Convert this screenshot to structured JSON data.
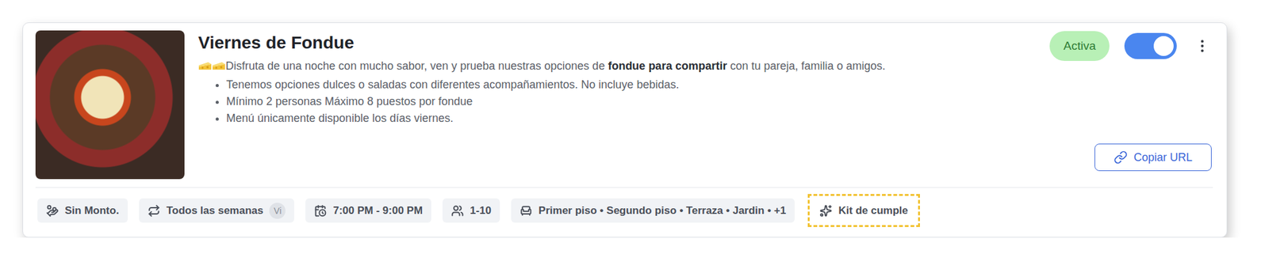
{
  "event": {
    "title": "Viernes de Fondue",
    "description": {
      "intro": "Disfruta de una noche con mucho sabor, ven y prueba nuestras opciones de ",
      "bold": "fondue para compartir",
      "outro": " con tu pareja, familia o amigos."
    },
    "bullets": [
      "Tenemos opciones dulces o saladas con diferentes acompañamientos. No incluye bebidas.",
      "Mínimo 2 personas Máximo 8 puestos por fondue",
      "Menú únicamente disponible los días viernes."
    ],
    "status": {
      "label": "Activa"
    },
    "toggle": {
      "on": true
    },
    "copy_button": "Copiar URL",
    "chips": [
      {
        "label": "Sin Monto.",
        "highlighted": false
      },
      {
        "label": "Todos las semanas",
        "badge": "Vi",
        "highlighted": false
      },
      {
        "label": "7:00 PM - 9:00 PM",
        "highlighted": false
      },
      {
        "label": "1-10",
        "highlighted": false
      },
      {
        "label": "Primer piso • Segundo piso • Terraza • Jardin • +1",
        "highlighted": false
      },
      {
        "label": "Kit de cumple",
        "highlighted": true
      }
    ]
  }
}
